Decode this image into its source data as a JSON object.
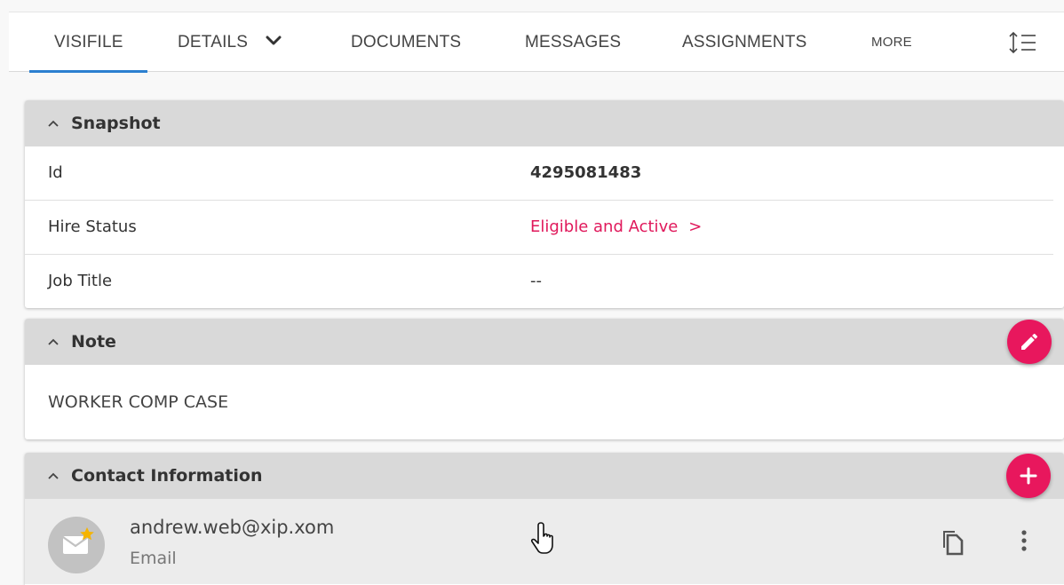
{
  "tabs": [
    {
      "label": "VISIFILE",
      "active": true
    },
    {
      "label": "DETAILS",
      "has_dropdown": true
    },
    {
      "label": "DOCUMENTS"
    },
    {
      "label": "MESSAGES"
    },
    {
      "label": "ASSIGNMENTS"
    },
    {
      "label": "MORE"
    }
  ],
  "toolbar": {
    "sort_icon": "sort-lines-icon"
  },
  "snapshot": {
    "title": "Snapshot",
    "rows": [
      {
        "label": "Id",
        "value": "4295081483"
      },
      {
        "label": "Hire Status",
        "value": "Eligible and Active",
        "arrow": ">"
      },
      {
        "label": "Job Title",
        "value": "--"
      }
    ]
  },
  "note": {
    "title": "Note",
    "text": "WORKER COMP CASE",
    "action_icon": "pencil-icon"
  },
  "contact": {
    "title": "Contact Information",
    "action_icon": "plus-icon",
    "items": [
      {
        "primary": "andrew.web@xip.xom",
        "secondary": "Email",
        "icon": "email-star-icon"
      }
    ]
  },
  "colors": {
    "accent": "#e8175d",
    "link": "#e0185b",
    "tab_underline": "#2b7fd0",
    "header_bg": "#d9d9d9"
  }
}
